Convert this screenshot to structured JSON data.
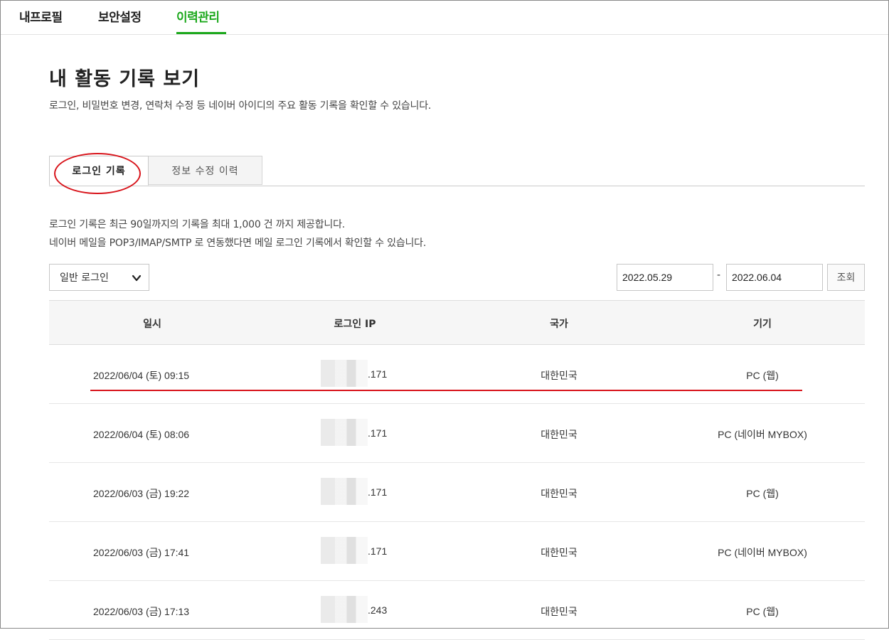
{
  "nav": {
    "items": [
      {
        "label": "내프로필",
        "active": false
      },
      {
        "label": "보안설정",
        "active": false
      },
      {
        "label": "이력관리",
        "active": true
      }
    ]
  },
  "page": {
    "title": "내 활동 기록 보기",
    "description": "로그인, 비밀번호 변경, 연락처 수정 등 네이버 아이디의 주요 활동 기록을 확인할 수 있습니다."
  },
  "tabs": [
    {
      "label": "로그인 기록",
      "active": true
    },
    {
      "label": "정보 수정 이력",
      "active": false
    }
  ],
  "info": {
    "line1": "로그인 기록은 최근 90일까지의 기록을 최대 1,000 건 까지 제공합니다.",
    "line2": "네이버 메일을 POP3/IMAP/SMTP 로 연동했다면 메일 로그인 기록에서 확인할 수 있습니다."
  },
  "filter": {
    "select_value": "일반 로그인",
    "date_from": "2022.05.29",
    "date_sep": "-",
    "date_to": "2022.06.04",
    "search_label": "조회"
  },
  "table": {
    "headers": [
      "일시",
      "로그인 IP",
      "국가",
      "기기"
    ],
    "rows": [
      {
        "datetime": "2022/06/04 (토) 09:15",
        "ip": ".171",
        "country": "대한민국",
        "device": "PC (웹)"
      },
      {
        "datetime": "2022/06/04 (토) 08:06",
        "ip": ".171",
        "country": "대한민국",
        "device": "PC (네이버 MYBOX)"
      },
      {
        "datetime": "2022/06/03 (금) 19:22",
        "ip": ".171",
        "country": "대한민국",
        "device": "PC (웹)"
      },
      {
        "datetime": "2022/06/03 (금) 17:41",
        "ip": ".171",
        "country": "대한민국",
        "device": "PC (네이버 MYBOX)"
      },
      {
        "datetime": "2022/06/03 (금) 17:13",
        "ip": ".243",
        "country": "대한민국",
        "device": "PC (웹)"
      }
    ]
  },
  "colors": {
    "accent_green": "#1ba81b",
    "annotation_red": "#d8141b"
  },
  "icons": {
    "select_chevron": "chevron-down-icon"
  }
}
